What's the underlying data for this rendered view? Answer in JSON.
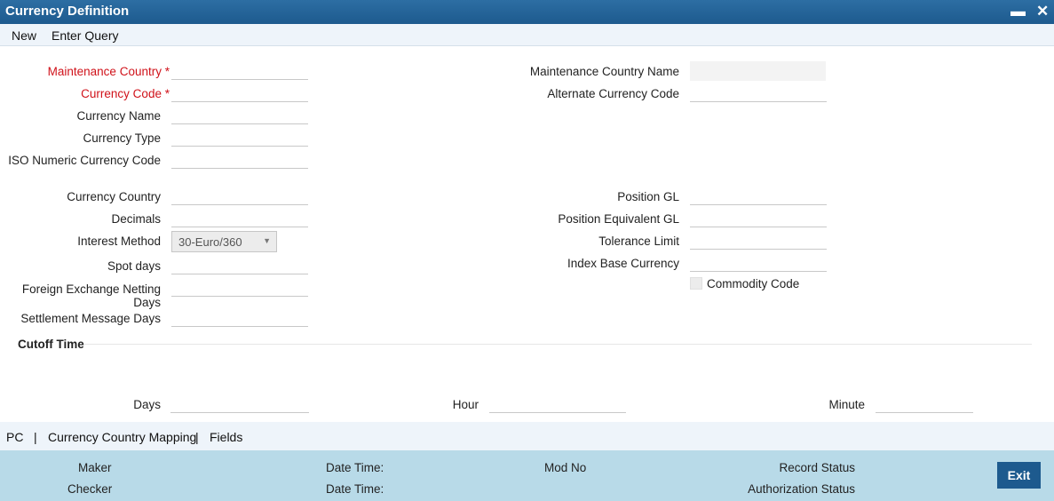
{
  "window": {
    "title": "Currency Definition",
    "minimize_glyph": "▬",
    "close_glyph": "✕"
  },
  "toolbar": {
    "new_label": "New",
    "enter_query_label": "Enter Query"
  },
  "form": {
    "maintenance_country": {
      "label": "Maintenance Country",
      "value": ""
    },
    "currency_code": {
      "label": "Currency Code",
      "value": ""
    },
    "required_mark": "*",
    "currency_name": {
      "label": "Currency Name",
      "value": ""
    },
    "currency_type": {
      "label": "Currency Type",
      "value": ""
    },
    "iso_numeric_currency_code": {
      "label": "ISO Numeric Currency Code",
      "value": ""
    },
    "currency_country": {
      "label": "Currency Country",
      "value": ""
    },
    "decimals": {
      "label": "Decimals",
      "value": ""
    },
    "interest_method": {
      "label": "Interest Method",
      "value": "30-Euro/360"
    },
    "spot_days": {
      "label": "Spot days",
      "value": ""
    },
    "fx_netting_days": {
      "label": "Foreign Exchange Netting Days",
      "value": ""
    },
    "settlement_message_days": {
      "label": "Settlement Message Days",
      "value": ""
    },
    "maintenance_country_name": {
      "label": "Maintenance Country Name",
      "value": ""
    },
    "alternate_currency_code": {
      "label": "Alternate Currency Code",
      "value": ""
    },
    "position_gl": {
      "label": "Position GL",
      "value": ""
    },
    "position_equivalent_gl": {
      "label": "Position Equivalent GL",
      "value": ""
    },
    "tolerance_limit": {
      "label": "Tolerance Limit",
      "value": ""
    },
    "index_base_currency": {
      "label": "Index Base Currency",
      "value": ""
    },
    "commodity_code": {
      "label": "Commodity Code",
      "checked": false
    }
  },
  "cutoff": {
    "section_title": "Cutoff Time",
    "days": {
      "label": "Days",
      "value": ""
    },
    "hour": {
      "label": "Hour",
      "value": ""
    },
    "minute": {
      "label": "Minute",
      "value": ""
    }
  },
  "subnav": {
    "items": [
      "PC",
      "Currency Country Mapping",
      "Fields"
    ],
    "separator": "|"
  },
  "footer": {
    "maker_label": "Maker",
    "checker_label": "Checker",
    "date_time_label_1": "Date Time:",
    "date_time_label_2": "Date Time:",
    "mod_no_label": "Mod No",
    "record_status_label": "Record Status",
    "authorization_status_label": "Authorization Status",
    "exit_label": "Exit"
  },
  "colors": {
    "title_bar": "#1d5a8e",
    "required": "#d0121a",
    "footer": "#b8dae8",
    "exit_button": "#1d5a8e"
  },
  "icons": {
    "minimize": "minimize-icon",
    "close": "close-icon",
    "dropdown": "chevron-down-icon"
  }
}
